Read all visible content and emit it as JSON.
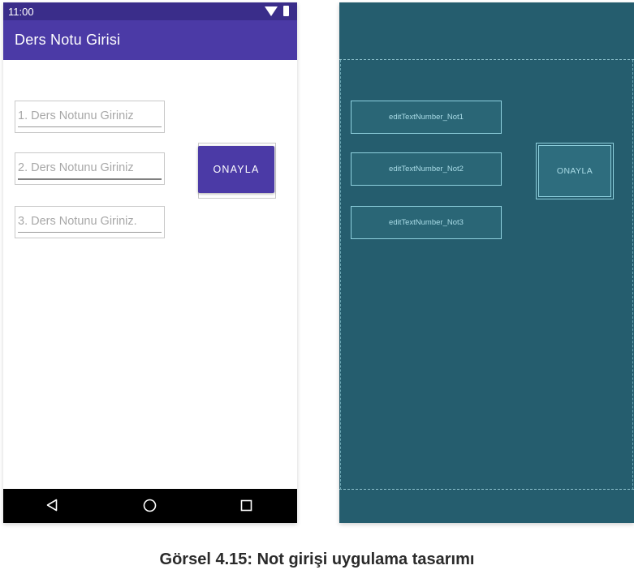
{
  "status_bar": {
    "time": "11:00",
    "wifi_icon": "wifi-icon",
    "battery_icon": "battery-icon"
  },
  "app_bar": {
    "title": "Ders Notu Girisi"
  },
  "form": {
    "fields": [
      {
        "hint": "1. Ders Notunu Giriniz",
        "value": ""
      },
      {
        "hint": "2. Ders Notunu Giriniz",
        "value": ""
      },
      {
        "hint": "3. Ders Notunu Giriniz.",
        "value": ""
      }
    ],
    "confirm_button": "ONAYLA"
  },
  "nav_bar": {
    "icons": [
      "back-icon",
      "home-icon",
      "recents-icon"
    ]
  },
  "blueprint": {
    "fields": [
      "editTextNumber_Not1",
      "editTextNumber_Not2",
      "editTextNumber_Not3"
    ],
    "button": "ONAYLA"
  },
  "caption": "Görsel 4.15: Not girişi uygulama tasarımı",
  "colors": {
    "app_bar": "#4b3aa6",
    "status_bar": "#3a2d8a",
    "blueprint_bg": "#255d6e",
    "blueprint_stroke": "#8ed0de"
  }
}
